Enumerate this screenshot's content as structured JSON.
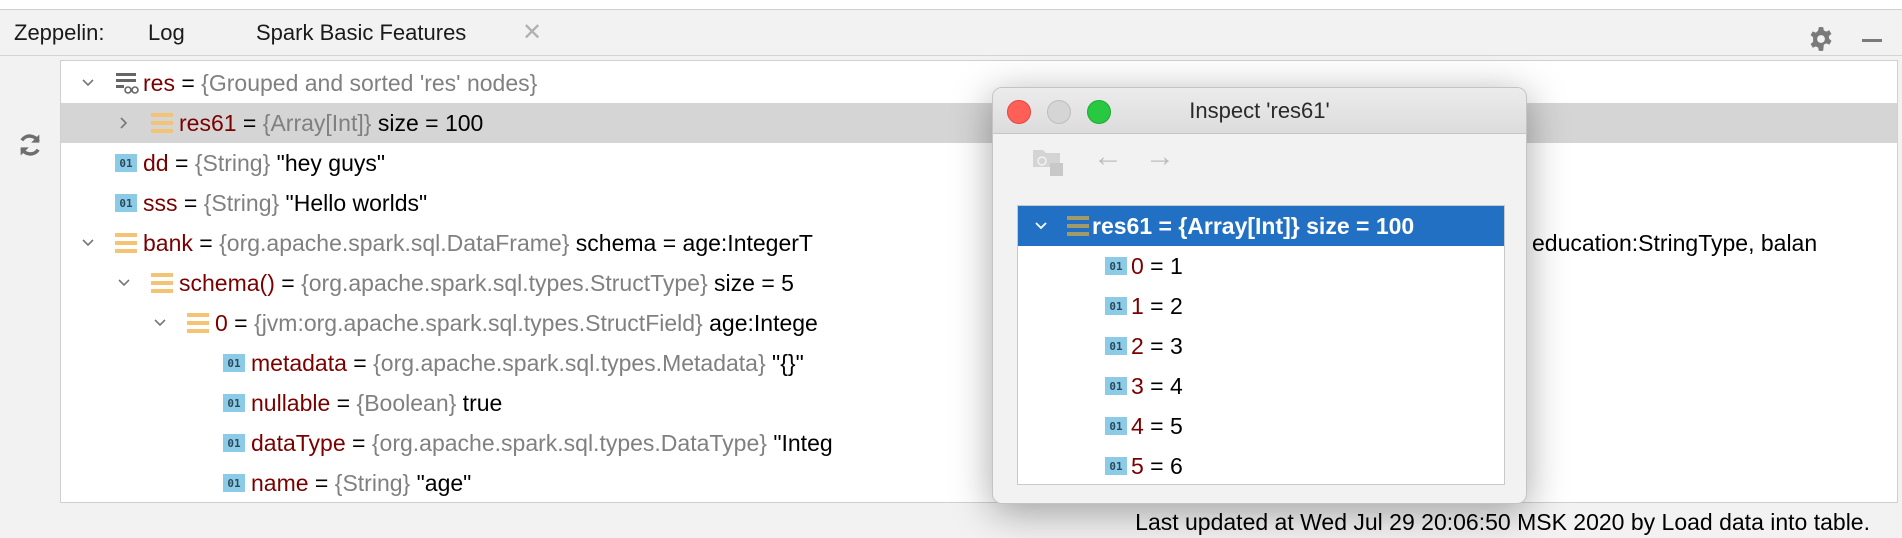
{
  "tabbar": {
    "prefix": "Zeppelin:",
    "tabs": [
      {
        "label": "Log"
      },
      {
        "label": "Spark Basic Features",
        "active": true
      }
    ]
  },
  "tree": {
    "rows": [
      {
        "name": "res",
        "eq": " = ",
        "type": "{Grouped and sorted 'res' nodes}",
        "value": "",
        "icon": "group-icon",
        "expanded": true
      },
      {
        "name": "res61",
        "eq": " = ",
        "type": "{Array[Int]}",
        "value": " size = 100",
        "icon": "array-icon",
        "expanded": false
      },
      {
        "name": "dd",
        "eq": " = ",
        "type": "{String}",
        "value": " \"hey guys\"",
        "icon": "primitive-icon"
      },
      {
        "name": "sss",
        "eq": " = ",
        "type": "{String}",
        "value": " \"Hello worlds\"",
        "icon": "primitive-icon"
      },
      {
        "name": "bank",
        "eq": " = ",
        "type": "{org.apache.spark.sql.DataFrame}",
        "value": " schema = age:IntegerT",
        "tail": "education:StringType, balan",
        "icon": "array-icon",
        "expanded": true
      },
      {
        "name": "schema()",
        "eq": " = ",
        "type": "{org.apache.spark.sql.types.StructType}",
        "value": " size = 5",
        "icon": "array-icon",
        "expanded": true
      },
      {
        "name": "0",
        "eq": " = ",
        "type": "{jvm:org.apache.spark.sql.types.StructField}",
        "value": " age:Intege",
        "icon": "array-icon",
        "expanded": true
      },
      {
        "name": "metadata",
        "eq": " = ",
        "type": "{org.apache.spark.sql.types.Metadata}",
        "value": " \"{}\"",
        "icon": "primitive-icon"
      },
      {
        "name": "nullable",
        "eq": " = ",
        "type": "{Boolean}",
        "value": " true",
        "icon": "primitive-icon"
      },
      {
        "name": "dataType",
        "eq": " = ",
        "type": "{org.apache.spark.sql.types.DataType}",
        "value": " \"Integ",
        "icon": "primitive-icon"
      },
      {
        "name": "name",
        "eq": " = ",
        "type": "{String}",
        "value": " \"age\"",
        "icon": "primitive-icon"
      }
    ]
  },
  "status": "Last updated at Wed Jul 29 20:06:50 MSK 2020 by Load data into table.",
  "dialog": {
    "title": "Inspect 'res61'",
    "root": "res61 = {Array[Int]} size = 100",
    "items": [
      {
        "k": "0",
        "v": " = 1"
      },
      {
        "k": "1",
        "v": " = 2"
      },
      {
        "k": "2",
        "v": " = 3"
      },
      {
        "k": "3",
        "v": " = 4"
      },
      {
        "k": "4",
        "v": " = 5"
      },
      {
        "k": "5",
        "v": " = 6"
      }
    ]
  },
  "icon_label": "01",
  "colors": {
    "selection": "#2270c3",
    "name": "#7a0000",
    "type": "#808080",
    "close": "#fe5f57",
    "zoom": "#28c840"
  }
}
